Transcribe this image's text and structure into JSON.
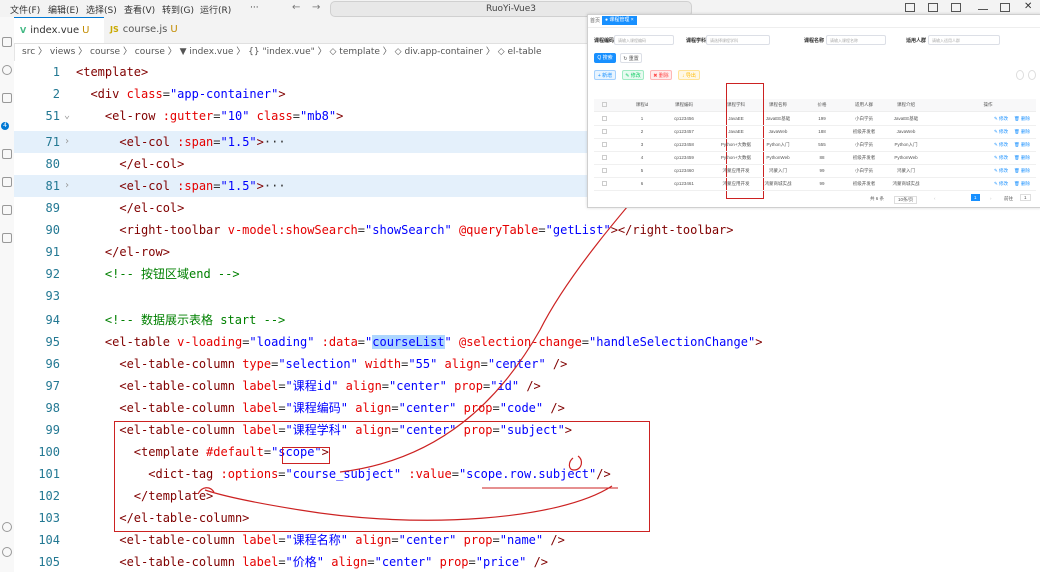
{
  "menubar": {
    "items": [
      "文件(F)",
      "编辑(E)",
      "选择(S)",
      "查看(V)",
      "转到(G)",
      "运行(R)",
      "···"
    ],
    "command_center": "RuoYi-Vue3",
    "back": "←",
    "forward": "→"
  },
  "activity": {
    "badge": "4"
  },
  "tabs": [
    {
      "icon": "V",
      "label": "index.vue",
      "status": "U",
      "active": true
    },
    {
      "icon": "JS",
      "label": "course.js",
      "status": "U",
      "active": false
    }
  ],
  "breadcrumb": "src 〉 views 〉 course 〉 course 〉 ▼ index.vue 〉 {} \"index.vue\" 〉 ◇ template 〉 ◇ div.app-container 〉 ◇ el-table",
  "code_lines": [
    {
      "n": "1",
      "fold": "",
      "hl": false,
      "parts": [
        [
          "tg",
          "<template>"
        ]
      ]
    },
    {
      "n": "2",
      "fold": "",
      "hl": false,
      "parts": [
        [
          "tx",
          "  "
        ],
        [
          "tg",
          "<div "
        ],
        [
          "at",
          "class"
        ],
        [
          "tx",
          "="
        ],
        [
          "st",
          "\"app-container\""
        ],
        [
          "tg",
          ">"
        ]
      ]
    },
    {
      "n": "51",
      "fold": "⌄",
      "hl": false,
      "parts": [
        [
          "tx",
          "    "
        ],
        [
          "tg",
          "<el-row "
        ],
        [
          "at",
          ":gutter"
        ],
        [
          "tx",
          "="
        ],
        [
          "st",
          "\"10\" "
        ],
        [
          "at",
          "class"
        ],
        [
          "tx",
          "="
        ],
        [
          "st",
          "\"mb8\""
        ],
        [
          "tg",
          ">"
        ]
      ]
    },
    {
      "n": "",
      "fold": "",
      "hl": false,
      "parts": []
    },
    {
      "n": "71",
      "fold": "›",
      "hl": true,
      "parts": [
        [
          "tx",
          "      "
        ],
        [
          "tg",
          "<el-col "
        ],
        [
          "at",
          ":span"
        ],
        [
          "tx",
          "="
        ],
        [
          "st",
          "\"1.5\""
        ],
        [
          "tg",
          ">"
        ],
        [
          "tx",
          "···"
        ]
      ]
    },
    {
      "n": "80",
      "fold": "",
      "hl": false,
      "parts": [
        [
          "tx",
          "      "
        ],
        [
          "tg",
          "</el-col>"
        ]
      ]
    },
    {
      "n": "81",
      "fold": "›",
      "hl": true,
      "parts": [
        [
          "tx",
          "      "
        ],
        [
          "tg",
          "<el-col "
        ],
        [
          "at",
          ":span"
        ],
        [
          "tx",
          "="
        ],
        [
          "st",
          "\"1.5\""
        ],
        [
          "tg",
          ">"
        ],
        [
          "tx",
          "···"
        ]
      ]
    },
    {
      "n": "89",
      "fold": "",
      "hl": false,
      "parts": [
        [
          "tx",
          "      "
        ],
        [
          "tg",
          "</el-col>"
        ]
      ]
    },
    {
      "n": "90",
      "fold": "",
      "hl": false,
      "parts": [
        [
          "tx",
          "      "
        ],
        [
          "tg",
          "<right-toolbar "
        ],
        [
          "at",
          "v-model:showSearch"
        ],
        [
          "tx",
          "="
        ],
        [
          "st",
          "\"showSearch\" "
        ],
        [
          "at",
          "@queryTable"
        ],
        [
          "tx",
          "="
        ],
        [
          "st",
          "\"getList\""
        ],
        [
          "tg",
          "></right-toolbar>"
        ]
      ]
    },
    {
      "n": "91",
      "fold": "",
      "hl": false,
      "parts": [
        [
          "tx",
          "    "
        ],
        [
          "tg",
          "</el-row>"
        ]
      ]
    },
    {
      "n": "92",
      "fold": "",
      "hl": false,
      "parts": [
        [
          "tx",
          "    "
        ],
        [
          "cm",
          "<!-- 按钮区域end -->"
        ]
      ]
    },
    {
      "n": "93",
      "fold": "",
      "hl": false,
      "parts": []
    },
    {
      "n": "94",
      "fold": "",
      "hl": false,
      "parts": [
        [
          "tx",
          "    "
        ],
        [
          "cm",
          "<!-- 数据展示表格 start -->"
        ]
      ]
    },
    {
      "n": "95",
      "fold": "",
      "hl": false,
      "parts": [
        [
          "tx",
          "    "
        ],
        [
          "tg",
          "<el-table "
        ],
        [
          "at",
          "v-loading"
        ],
        [
          "tx",
          "="
        ],
        [
          "st",
          "\"loading\" "
        ],
        [
          "at",
          ":data"
        ],
        [
          "tx",
          "="
        ],
        [
          "st",
          "\""
        ],
        [
          "box",
          "courseList"
        ],
        [
          "st",
          "\" "
        ],
        [
          "at",
          "@selection-change"
        ],
        [
          "tx",
          "="
        ],
        [
          "st",
          "\"handleSelectionChange\""
        ],
        [
          "tg",
          ">"
        ]
      ]
    },
    {
      "n": "96",
      "fold": "",
      "hl": false,
      "parts": [
        [
          "tx",
          "      "
        ],
        [
          "tg",
          "<el-table-column "
        ],
        [
          "at",
          "type"
        ],
        [
          "tx",
          "="
        ],
        [
          "st",
          "\"selection\" "
        ],
        [
          "at",
          "width"
        ],
        [
          "tx",
          "="
        ],
        [
          "st",
          "\"55\" "
        ],
        [
          "at",
          "align"
        ],
        [
          "tx",
          "="
        ],
        [
          "st",
          "\"center\" "
        ],
        [
          "tg",
          "/>"
        ]
      ]
    },
    {
      "n": "97",
      "fold": "",
      "hl": false,
      "parts": [
        [
          "tx",
          "      "
        ],
        [
          "tg",
          "<el-table-column "
        ],
        [
          "at",
          "label"
        ],
        [
          "tx",
          "="
        ],
        [
          "st",
          "\"课程id\" "
        ],
        [
          "at",
          "align"
        ],
        [
          "tx",
          "="
        ],
        [
          "st",
          "\"center\" "
        ],
        [
          "at",
          "prop"
        ],
        [
          "tx",
          "="
        ],
        [
          "st",
          "\"id\" "
        ],
        [
          "tg",
          "/>"
        ]
      ]
    },
    {
      "n": "98",
      "fold": "",
      "hl": false,
      "parts": [
        [
          "tx",
          "      "
        ],
        [
          "tg",
          "<el-table-column "
        ],
        [
          "at",
          "label"
        ],
        [
          "tx",
          "="
        ],
        [
          "st",
          "\"课程编码\" "
        ],
        [
          "at",
          "align"
        ],
        [
          "tx",
          "="
        ],
        [
          "st",
          "\"center\" "
        ],
        [
          "at",
          "prop"
        ],
        [
          "tx",
          "="
        ],
        [
          "st",
          "\"code\" "
        ],
        [
          "tg",
          "/>"
        ]
      ]
    },
    {
      "n": "99",
      "fold": "",
      "hl": false,
      "parts": [
        [
          "tx",
          "      "
        ],
        [
          "tg",
          "<el-table-column "
        ],
        [
          "at",
          "label"
        ],
        [
          "tx",
          "="
        ],
        [
          "st",
          "\"课程学科\" "
        ],
        [
          "at",
          "align"
        ],
        [
          "tx",
          "="
        ],
        [
          "st",
          "\"center\" "
        ],
        [
          "at",
          "prop"
        ],
        [
          "tx",
          "="
        ],
        [
          "st",
          "\"subject\""
        ],
        [
          "tg",
          ">"
        ]
      ]
    },
    {
      "n": "100",
      "fold": "",
      "hl": false,
      "parts": [
        [
          "tx",
          "        "
        ],
        [
          "tg",
          "<template "
        ],
        [
          "at",
          "#default"
        ],
        [
          "tx",
          "="
        ],
        [
          "st",
          "\"scope\""
        ],
        [
          "tg",
          ">"
        ]
      ]
    },
    {
      "n": "101",
      "fold": "",
      "hl": false,
      "parts": [
        [
          "tx",
          "          "
        ],
        [
          "tg",
          "<dict-tag "
        ],
        [
          "at",
          ":options"
        ],
        [
          "tx",
          "="
        ],
        [
          "st",
          "\"course_subject\" "
        ],
        [
          "at",
          ":value"
        ],
        [
          "tx",
          "="
        ],
        [
          "st",
          "\"scope.row.subject\""
        ],
        [
          "tg",
          "/>"
        ]
      ]
    },
    {
      "n": "102",
      "fold": "",
      "hl": false,
      "parts": [
        [
          "tx",
          "        "
        ],
        [
          "tg",
          "</template>"
        ]
      ]
    },
    {
      "n": "103",
      "fold": "",
      "hl": false,
      "parts": [
        [
          "tx",
          "      "
        ],
        [
          "tg",
          "</el-table-column>"
        ]
      ]
    },
    {
      "n": "104",
      "fold": "",
      "hl": false,
      "parts": [
        [
          "tx",
          "      "
        ],
        [
          "tg",
          "<el-table-column "
        ],
        [
          "at",
          "label"
        ],
        [
          "tx",
          "="
        ],
        [
          "st",
          "\"课程名称\" "
        ],
        [
          "at",
          "align"
        ],
        [
          "tx",
          "="
        ],
        [
          "st",
          "\"center\" "
        ],
        [
          "at",
          "prop"
        ],
        [
          "tx",
          "="
        ],
        [
          "st",
          "\"name\" "
        ],
        [
          "tg",
          "/>"
        ]
      ]
    },
    {
      "n": "105",
      "fold": "",
      "hl": false,
      "parts": [
        [
          "tx",
          "      "
        ],
        [
          "tg",
          "<el-table-column "
        ],
        [
          "at",
          "label"
        ],
        [
          "tx",
          "="
        ],
        [
          "st",
          "\"价格\" "
        ],
        [
          "at",
          "align"
        ],
        [
          "tx",
          "="
        ],
        [
          "st",
          "\"center\" "
        ],
        [
          "at",
          "prop"
        ],
        [
          "tx",
          "="
        ],
        [
          "st",
          "\"price\" "
        ],
        [
          "tg",
          "/>"
        ]
      ]
    }
  ],
  "preview": {
    "tab_home": "首页",
    "tab_active": "● 课程管理 ×",
    "filters": [
      {
        "label": "课程编码",
        "placeholder": "请输入课程编码"
      },
      {
        "label": "课程学科",
        "placeholder": "请选择课程学科"
      },
      {
        "label": "课程名称",
        "placeholder": "请输入课程名称"
      },
      {
        "label": "适用人群",
        "placeholder": "请输入适用人群"
      }
    ],
    "search_btn": "Q 搜索",
    "reset_btn": "↻ 重置",
    "action_btns": [
      "+ 新增",
      "✎ 修改",
      "✖ 删除",
      "↓ 导出"
    ],
    "columns": [
      "课程id",
      "课程编码",
      "课程学科",
      "课程名称",
      "价格",
      "适用人群",
      "课程介绍",
      "操作"
    ],
    "rows": [
      [
        "1",
        "cp123456",
        "JavaEE",
        "JavaEE基础",
        "199",
        "小白学员",
        "JavaEE基础"
      ],
      [
        "2",
        "cp123457",
        "JavaEE",
        "JavaWeb",
        "188",
        "初级开发者",
        "JavaWeb"
      ],
      [
        "3",
        "cp123458",
        "Python+大数据",
        "Python入门",
        "555",
        "小白学员",
        "Python入门"
      ],
      [
        "4",
        "cp123459",
        "Python+大数据",
        "PythonWeb",
        "88",
        "初级开发者",
        "PythonWeb"
      ],
      [
        "5",
        "cp123460",
        "鸿蒙应用开发",
        "鸿蒙入门",
        "99",
        "小白学员",
        "鸿蒙入门"
      ],
      [
        "6",
        "cp123461",
        "鸿蒙应用开发",
        "鸿蒙商城实战",
        "99",
        "初级开发者",
        "鸿蒙商城实战"
      ]
    ],
    "op_edit": "✎ 修改",
    "op_delete": "🗑 删除",
    "pager_total": "共 6 条",
    "pager_size": "10条/页",
    "pager_page": "1",
    "pager_goto": "前往",
    "pager_goto_val": "1"
  },
  "colors": {
    "accent": "#0078d4",
    "annotation": "#cc2222",
    "element_primary": "#1890ff"
  }
}
